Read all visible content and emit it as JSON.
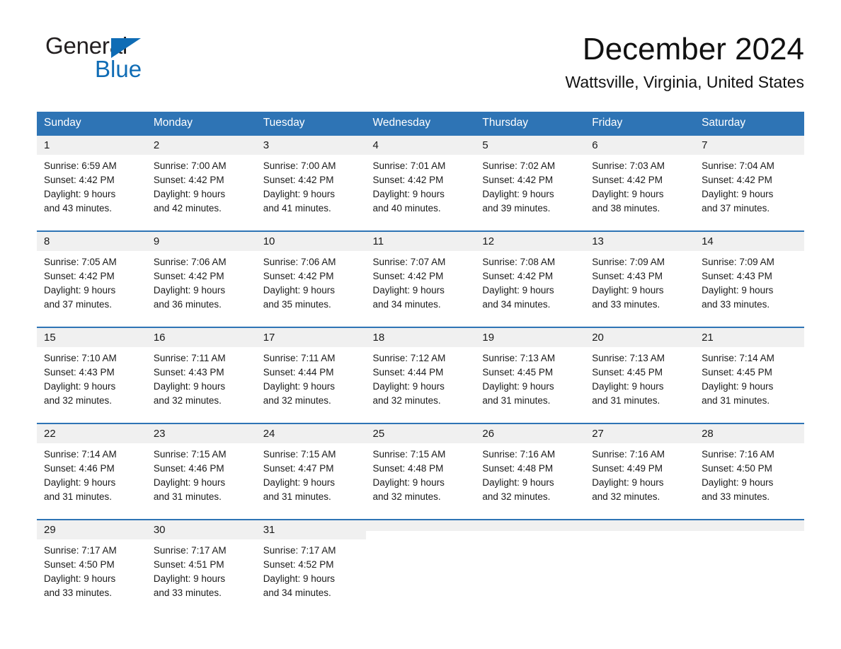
{
  "brand": {
    "name_part1": "General",
    "name_part2": "Blue",
    "triangle_color": "#0f6cb5",
    "logo_icon": "triangle-icon"
  },
  "header": {
    "month_title": "December 2024",
    "location": "Wattsville, Virginia, United States",
    "accent_color": "#2e74b5",
    "day_band_color": "#f0f0f0"
  },
  "calendar": {
    "weekday_headers": [
      "Sunday",
      "Monday",
      "Tuesday",
      "Wednesday",
      "Thursday",
      "Friday",
      "Saturday"
    ],
    "labels": {
      "sunrise_prefix": "Sunrise:",
      "sunset_prefix": "Sunset:",
      "daylight_prefix": "Daylight:"
    },
    "weeks": [
      [
        {
          "day": "1",
          "sunrise": "Sunrise: 6:59 AM",
          "sunset": "Sunset: 4:42 PM",
          "daylight_line1": "Daylight: 9 hours",
          "daylight_line2": "and 43 minutes."
        },
        {
          "day": "2",
          "sunrise": "Sunrise: 7:00 AM",
          "sunset": "Sunset: 4:42 PM",
          "daylight_line1": "Daylight: 9 hours",
          "daylight_line2": "and 42 minutes."
        },
        {
          "day": "3",
          "sunrise": "Sunrise: 7:00 AM",
          "sunset": "Sunset: 4:42 PM",
          "daylight_line1": "Daylight: 9 hours",
          "daylight_line2": "and 41 minutes."
        },
        {
          "day": "4",
          "sunrise": "Sunrise: 7:01 AM",
          "sunset": "Sunset: 4:42 PM",
          "daylight_line1": "Daylight: 9 hours",
          "daylight_line2": "and 40 minutes."
        },
        {
          "day": "5",
          "sunrise": "Sunrise: 7:02 AM",
          "sunset": "Sunset: 4:42 PM",
          "daylight_line1": "Daylight: 9 hours",
          "daylight_line2": "and 39 minutes."
        },
        {
          "day": "6",
          "sunrise": "Sunrise: 7:03 AM",
          "sunset": "Sunset: 4:42 PM",
          "daylight_line1": "Daylight: 9 hours",
          "daylight_line2": "and 38 minutes."
        },
        {
          "day": "7",
          "sunrise": "Sunrise: 7:04 AM",
          "sunset": "Sunset: 4:42 PM",
          "daylight_line1": "Daylight: 9 hours",
          "daylight_line2": "and 37 minutes."
        }
      ],
      [
        {
          "day": "8",
          "sunrise": "Sunrise: 7:05 AM",
          "sunset": "Sunset: 4:42 PM",
          "daylight_line1": "Daylight: 9 hours",
          "daylight_line2": "and 37 minutes."
        },
        {
          "day": "9",
          "sunrise": "Sunrise: 7:06 AM",
          "sunset": "Sunset: 4:42 PM",
          "daylight_line1": "Daylight: 9 hours",
          "daylight_line2": "and 36 minutes."
        },
        {
          "day": "10",
          "sunrise": "Sunrise: 7:06 AM",
          "sunset": "Sunset: 4:42 PM",
          "daylight_line1": "Daylight: 9 hours",
          "daylight_line2": "and 35 minutes."
        },
        {
          "day": "11",
          "sunrise": "Sunrise: 7:07 AM",
          "sunset": "Sunset: 4:42 PM",
          "daylight_line1": "Daylight: 9 hours",
          "daylight_line2": "and 34 minutes."
        },
        {
          "day": "12",
          "sunrise": "Sunrise: 7:08 AM",
          "sunset": "Sunset: 4:42 PM",
          "daylight_line1": "Daylight: 9 hours",
          "daylight_line2": "and 34 minutes."
        },
        {
          "day": "13",
          "sunrise": "Sunrise: 7:09 AM",
          "sunset": "Sunset: 4:43 PM",
          "daylight_line1": "Daylight: 9 hours",
          "daylight_line2": "and 33 minutes."
        },
        {
          "day": "14",
          "sunrise": "Sunrise: 7:09 AM",
          "sunset": "Sunset: 4:43 PM",
          "daylight_line1": "Daylight: 9 hours",
          "daylight_line2": "and 33 minutes."
        }
      ],
      [
        {
          "day": "15",
          "sunrise": "Sunrise: 7:10 AM",
          "sunset": "Sunset: 4:43 PM",
          "daylight_line1": "Daylight: 9 hours",
          "daylight_line2": "and 32 minutes."
        },
        {
          "day": "16",
          "sunrise": "Sunrise: 7:11 AM",
          "sunset": "Sunset: 4:43 PM",
          "daylight_line1": "Daylight: 9 hours",
          "daylight_line2": "and 32 minutes."
        },
        {
          "day": "17",
          "sunrise": "Sunrise: 7:11 AM",
          "sunset": "Sunset: 4:44 PM",
          "daylight_line1": "Daylight: 9 hours",
          "daylight_line2": "and 32 minutes."
        },
        {
          "day": "18",
          "sunrise": "Sunrise: 7:12 AM",
          "sunset": "Sunset: 4:44 PM",
          "daylight_line1": "Daylight: 9 hours",
          "daylight_line2": "and 32 minutes."
        },
        {
          "day": "19",
          "sunrise": "Sunrise: 7:13 AM",
          "sunset": "Sunset: 4:45 PM",
          "daylight_line1": "Daylight: 9 hours",
          "daylight_line2": "and 31 minutes."
        },
        {
          "day": "20",
          "sunrise": "Sunrise: 7:13 AM",
          "sunset": "Sunset: 4:45 PM",
          "daylight_line1": "Daylight: 9 hours",
          "daylight_line2": "and 31 minutes."
        },
        {
          "day": "21",
          "sunrise": "Sunrise: 7:14 AM",
          "sunset": "Sunset: 4:45 PM",
          "daylight_line1": "Daylight: 9 hours",
          "daylight_line2": "and 31 minutes."
        }
      ],
      [
        {
          "day": "22",
          "sunrise": "Sunrise: 7:14 AM",
          "sunset": "Sunset: 4:46 PM",
          "daylight_line1": "Daylight: 9 hours",
          "daylight_line2": "and 31 minutes."
        },
        {
          "day": "23",
          "sunrise": "Sunrise: 7:15 AM",
          "sunset": "Sunset: 4:46 PM",
          "daylight_line1": "Daylight: 9 hours",
          "daylight_line2": "and 31 minutes."
        },
        {
          "day": "24",
          "sunrise": "Sunrise: 7:15 AM",
          "sunset": "Sunset: 4:47 PM",
          "daylight_line1": "Daylight: 9 hours",
          "daylight_line2": "and 31 minutes."
        },
        {
          "day": "25",
          "sunrise": "Sunrise: 7:15 AM",
          "sunset": "Sunset: 4:48 PM",
          "daylight_line1": "Daylight: 9 hours",
          "daylight_line2": "and 32 minutes."
        },
        {
          "day": "26",
          "sunrise": "Sunrise: 7:16 AM",
          "sunset": "Sunset: 4:48 PM",
          "daylight_line1": "Daylight: 9 hours",
          "daylight_line2": "and 32 minutes."
        },
        {
          "day": "27",
          "sunrise": "Sunrise: 7:16 AM",
          "sunset": "Sunset: 4:49 PM",
          "daylight_line1": "Daylight: 9 hours",
          "daylight_line2": "and 32 minutes."
        },
        {
          "day": "28",
          "sunrise": "Sunrise: 7:16 AM",
          "sunset": "Sunset: 4:50 PM",
          "daylight_line1": "Daylight: 9 hours",
          "daylight_line2": "and 33 minutes."
        }
      ],
      [
        {
          "day": "29",
          "sunrise": "Sunrise: 7:17 AM",
          "sunset": "Sunset: 4:50 PM",
          "daylight_line1": "Daylight: 9 hours",
          "daylight_line2": "and 33 minutes."
        },
        {
          "day": "30",
          "sunrise": "Sunrise: 7:17 AM",
          "sunset": "Sunset: 4:51 PM",
          "daylight_line1": "Daylight: 9 hours",
          "daylight_line2": "and 33 minutes."
        },
        {
          "day": "31",
          "sunrise": "Sunrise: 7:17 AM",
          "sunset": "Sunset: 4:52 PM",
          "daylight_line1": "Daylight: 9 hours",
          "daylight_line2": "and 34 minutes."
        },
        {
          "day": "",
          "sunrise": "",
          "sunset": "",
          "daylight_line1": "",
          "daylight_line2": ""
        },
        {
          "day": "",
          "sunrise": "",
          "sunset": "",
          "daylight_line1": "",
          "daylight_line2": ""
        },
        {
          "day": "",
          "sunrise": "",
          "sunset": "",
          "daylight_line1": "",
          "daylight_line2": ""
        },
        {
          "day": "",
          "sunrise": "",
          "sunset": "",
          "daylight_line1": "",
          "daylight_line2": ""
        }
      ]
    ]
  }
}
